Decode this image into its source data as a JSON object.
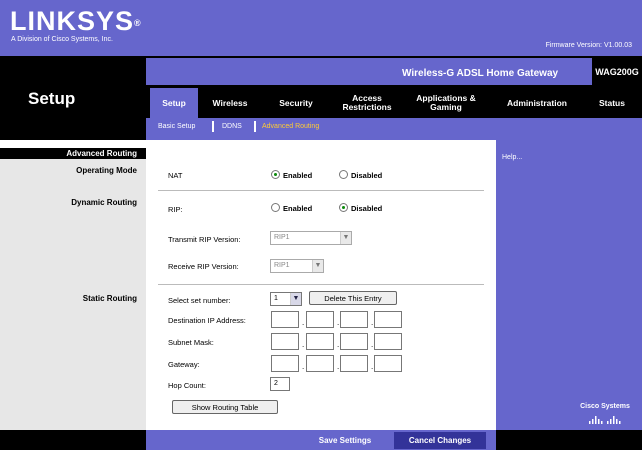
{
  "header": {
    "logo": "LINKSYS",
    "logo_tm": "®",
    "logo_sub": "A Division of Cisco Systems, Inc.",
    "firmware_label": "Firmware Version:",
    "firmware_value": "V1.00.03"
  },
  "product": {
    "name": "Wireless-G ADSL Home Gateway",
    "model": "WAG200G"
  },
  "section_title": "Setup",
  "tabs": [
    {
      "label": "Setup"
    },
    {
      "label": "Wireless"
    },
    {
      "label": "Security"
    },
    {
      "label": "Access Restrictions"
    },
    {
      "label": "Applications & Gaming"
    },
    {
      "label": "Administration"
    },
    {
      "label": "Status"
    }
  ],
  "subtabs": [
    {
      "label": "Basic Setup"
    },
    {
      "label": "DDNS"
    },
    {
      "label": "Advanced Routing"
    }
  ],
  "sidebar": {
    "heading": "Advanced Routing",
    "operating_mode": "Operating Mode",
    "dynamic_routing": "Dynamic Routing",
    "static_routing": "Static Routing"
  },
  "operating_mode": {
    "label": "NAT",
    "enabled": "Enabled",
    "disabled": "Disabled",
    "selected": "Enabled"
  },
  "dynamic_routing": {
    "rip_label": "RIP:",
    "enabled": "Enabled",
    "disabled": "Disabled",
    "selected": "Disabled",
    "transmit_label": "Transmit RIP Version:",
    "transmit_value": "RIP1",
    "receive_label": "Receive RIP Version:",
    "receive_value": "RIP1"
  },
  "static_routing": {
    "set_number_label": "Select set number:",
    "set_number_value": "1",
    "delete_button": "Delete This Entry",
    "dest_ip_label": "Destination IP Address:",
    "subnet_label": "Subnet Mask:",
    "gateway_label": "Gateway:",
    "hop_label": "Hop Count:",
    "hop_value": "2",
    "show_table_button": "Show Routing Table"
  },
  "help": "Help...",
  "cisco": "Cisco Systems",
  "footer": {
    "save": "Save Settings",
    "cancel": "Cancel Changes"
  },
  "colors": {
    "brand_purple": "#6666cc",
    "header_black": "#000000",
    "sidebar_gray": "#e7e7e7",
    "current_subtab": "#ffcc33",
    "cancel_bg": "#333399"
  }
}
